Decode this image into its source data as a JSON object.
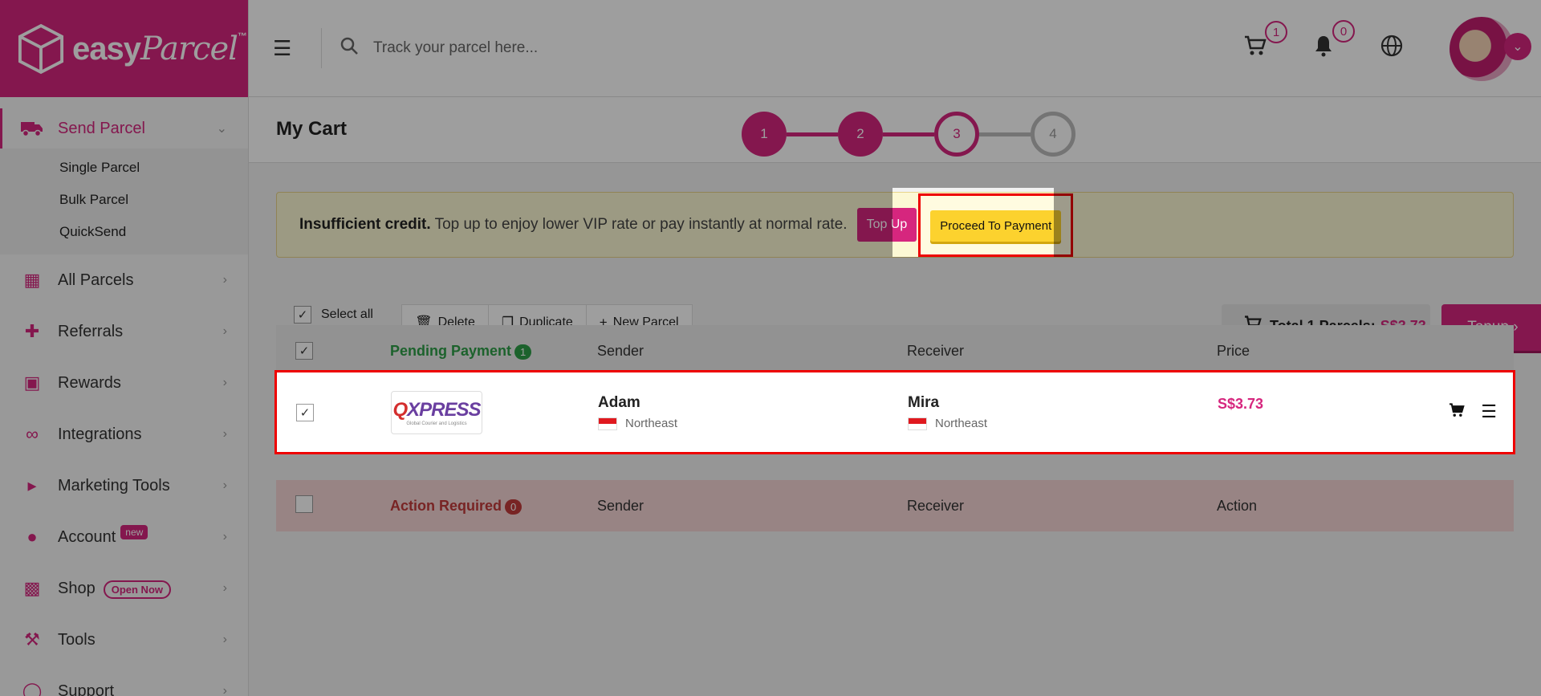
{
  "brand": {
    "name": "easy",
    "name2": "Parcel",
    "tm": "™"
  },
  "sidebar": {
    "items": [
      {
        "label": "Send Parcel",
        "icon": "truck-icon",
        "active": true,
        "sub": [
          "Single Parcel",
          "Bulk Parcel",
          "QuickSend"
        ]
      },
      {
        "label": "All Parcels",
        "icon": "boxes-icon"
      },
      {
        "label": "Referrals",
        "icon": "add-user-icon"
      },
      {
        "label": "Rewards",
        "icon": "gift-icon"
      },
      {
        "label": "Integrations",
        "icon": "link-icon"
      },
      {
        "label": "Marketing Tools",
        "icon": "megaphone-icon"
      },
      {
        "label": "Account",
        "icon": "person-icon",
        "badge": "new"
      },
      {
        "label": "Shop",
        "icon": "store-icon",
        "badge": "Open Now"
      },
      {
        "label": "Tools",
        "icon": "wrench-icon"
      },
      {
        "label": "Support",
        "icon": "support-icon"
      }
    ]
  },
  "header": {
    "search_placeholder": "Track your parcel here...",
    "cart_count": "1",
    "notif_count": "0"
  },
  "page": {
    "title": "My Cart",
    "steps": [
      "1",
      "2",
      "3",
      "4"
    ]
  },
  "alert": {
    "bold": "Insufficient credit.",
    "text": " Top up to enjoy lower VIP rate or pay instantly at normal rate.",
    "topup_label": "Top Up",
    "proceed_label": "Proceed To Payment"
  },
  "toolbar": {
    "select_all": "Select all",
    "delete": "Delete",
    "duplicate": "Duplicate",
    "new_parcel": "New Parcel",
    "total_label": "Total 1 Parcels:",
    "total_amount": "S$3.73",
    "topup_label": "Topup"
  },
  "pending": {
    "label": "Pending Payment",
    "count": "1",
    "columns": {
      "sender": "Sender",
      "receiver": "Receiver",
      "price": "Price"
    },
    "rows": [
      {
        "courier": "QXPRESS",
        "sender_name": "Adam",
        "sender_loc": "Northeast",
        "receiver_name": "Mira",
        "receiver_loc": "Northeast",
        "price": "S$3.73"
      }
    ]
  },
  "action_required": {
    "label": "Action Required",
    "count": "0",
    "columns": {
      "sender": "Sender",
      "receiver": "Receiver",
      "action": "Action"
    }
  },
  "colors": {
    "brand": "#d6267e",
    "success": "#2e9e48",
    "danger": "#c23b3b",
    "highlight": "#ee0000"
  }
}
